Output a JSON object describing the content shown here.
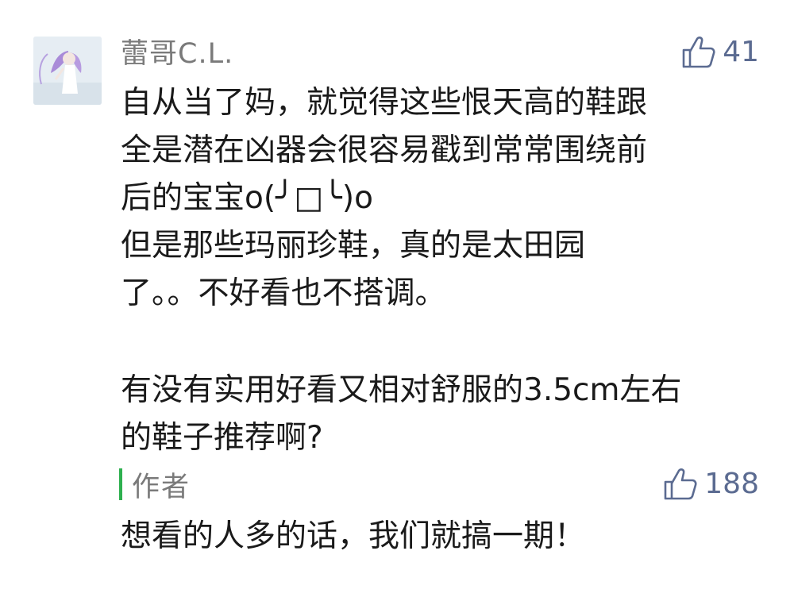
{
  "comment": {
    "username": "蕾哥C.L.",
    "like_count": "41",
    "avatar_icon": "avatar-girl-icon",
    "lines": [
      "自从当了妈，就觉得这些恨天高的鞋跟",
      "全是潜在凶器会很容易戳到常常围绕前",
      "后的宝宝o(╯□╰)o",
      "但是那些玛丽珍鞋，真的是太田园",
      "了。。不好看也不搭调。",
      "",
      "有没有实用好看又相对舒服的3.5cm左右",
      "的鞋子推荐啊?"
    ]
  },
  "reply": {
    "author_label": "作者",
    "like_count": "188",
    "text": "想看的人多的话，我们就搞一期！"
  },
  "colors": {
    "like_blue": "#5b6b91",
    "author_bar_green": "#2eb04f",
    "meta_gray": "#7a7a7a",
    "text": "#1a1a1a"
  }
}
